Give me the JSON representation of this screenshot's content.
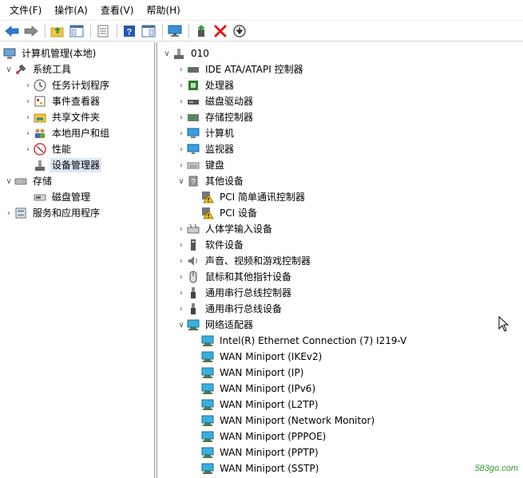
{
  "menu": [
    "文件(F)",
    "操作(A)",
    "查看(V)",
    "帮助(H)"
  ],
  "toolbar_icons": [
    "back-arrow-icon",
    "forward-arrow-icon",
    "up-folder-icon",
    "show-tree-icon",
    "properties-icon",
    "help-icon",
    "action-pane-icon",
    "monitor-icon",
    "update-driver-icon",
    "uninstall-icon",
    "download-icon"
  ],
  "left_tree": {
    "root": "计算机管理(本地)",
    "system_tools": "系统工具",
    "task_scheduler": "任务计划程序",
    "event_viewer": "事件查看器",
    "shared_folders": "共享文件夹",
    "local_users": "本地用户和组",
    "performance": "性能",
    "device_manager": "设备管理器",
    "storage": "存储",
    "disk_management": "磁盘管理",
    "services_apps": "服务和应用程序"
  },
  "right_tree": {
    "root": "010",
    "items": [
      {
        "label": "IDE ATA/ATAPI 控制器",
        "expanded": false
      },
      {
        "label": "处理器",
        "expanded": false
      },
      {
        "label": "磁盘驱动器",
        "expanded": false
      },
      {
        "label": "存储控制器",
        "expanded": false
      },
      {
        "label": "计算机",
        "expanded": false
      },
      {
        "label": "监视器",
        "expanded": false
      },
      {
        "label": "键盘",
        "expanded": false
      },
      {
        "label": "其他设备",
        "expanded": true
      },
      {
        "label": "PCI 简单通讯控制器",
        "child": true
      },
      {
        "label": "PCI 设备",
        "child": true
      },
      {
        "label": "人体学输入设备",
        "expanded": false
      },
      {
        "label": "软件设备",
        "expanded": false
      },
      {
        "label": "声音、视频和游戏控制器",
        "expanded": false
      },
      {
        "label": "鼠标和其他指针设备",
        "expanded": false
      },
      {
        "label": "通用串行总线控制器",
        "expanded": false
      },
      {
        "label": "通用串行总线设备",
        "expanded": false
      },
      {
        "label": "网络适配器",
        "expanded": true
      },
      {
        "label": "Intel(R) Ethernet Connection (7) I219-V",
        "child": true
      },
      {
        "label": "WAN Miniport (IKEv2)",
        "child": true
      },
      {
        "label": "WAN Miniport (IP)",
        "child": true
      },
      {
        "label": "WAN Miniport (IPv6)",
        "child": true
      },
      {
        "label": "WAN Miniport (L2TP)",
        "child": true
      },
      {
        "label": "WAN Miniport (Network Monitor)",
        "child": true
      },
      {
        "label": "WAN Miniport (PPPOE)",
        "child": true
      },
      {
        "label": "WAN Miniport (PPTP)",
        "child": true
      },
      {
        "label": "WAN Miniport (SSTP)",
        "child": true
      }
    ]
  },
  "watermark": "583go.com"
}
